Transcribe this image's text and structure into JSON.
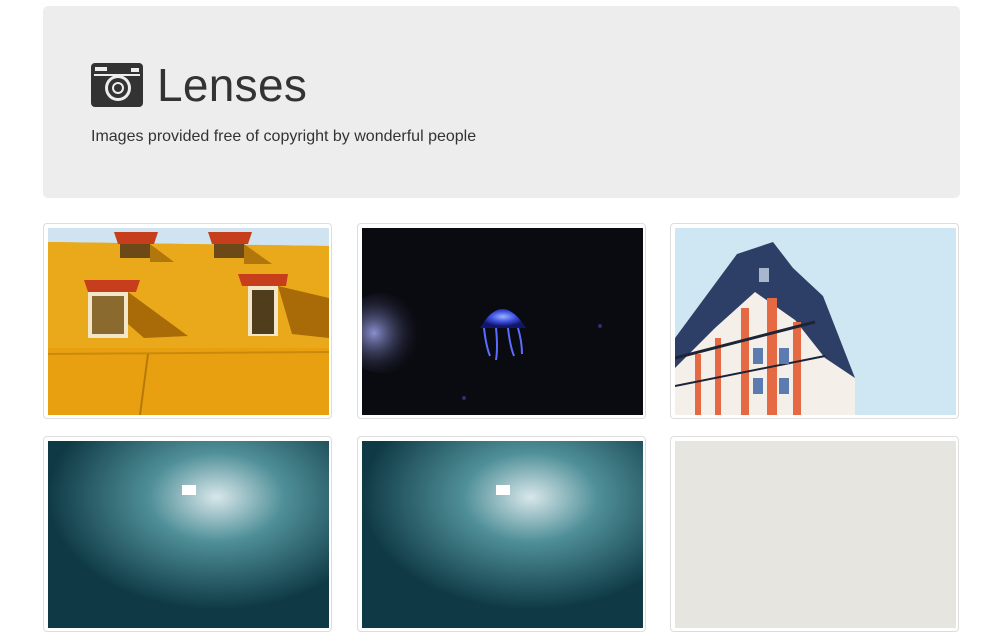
{
  "header": {
    "title": "Lenses",
    "subtitle": "Images provided free of copyright by wonderful people",
    "icon": "camera-icon"
  },
  "gallery": {
    "items": [
      {
        "subject": "yellow-wall-windows"
      },
      {
        "subject": "jellyfish"
      },
      {
        "subject": "parisian-building"
      },
      {
        "subject": "blurred-teal-light"
      },
      {
        "subject": "blurred-teal-light"
      },
      {
        "subject": "pale-grey"
      }
    ]
  },
  "colors": {
    "jumbotron_bg": "#ededed",
    "text": "#333333",
    "thumb_border": "#dddddd"
  }
}
